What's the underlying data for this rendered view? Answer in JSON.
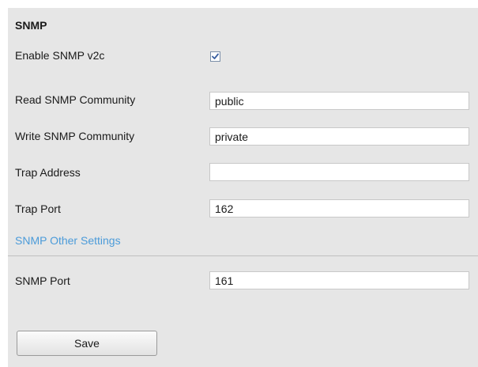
{
  "snmp": {
    "title": "SNMP",
    "enable_v2c": {
      "label": "Enable SNMP v2c",
      "checked": true
    },
    "read_community": {
      "label": "Read SNMP Community",
      "value": "public"
    },
    "write_community": {
      "label": "Write SNMP Community",
      "value": "private"
    },
    "trap_address": {
      "label": "Trap Address",
      "value": ""
    },
    "trap_port": {
      "label": "Trap Port",
      "value": "162"
    },
    "other_settings_title": "SNMP Other Settings",
    "snmp_port": {
      "label": "SNMP Port",
      "value": "161"
    },
    "save_label": "Save"
  },
  "colors": {
    "panel_background": "#e6e6e6",
    "section_link": "#4b9bd9",
    "checkmark": "#3a5fa0"
  },
  "icons": {
    "checkbox": "checkmark-icon"
  }
}
